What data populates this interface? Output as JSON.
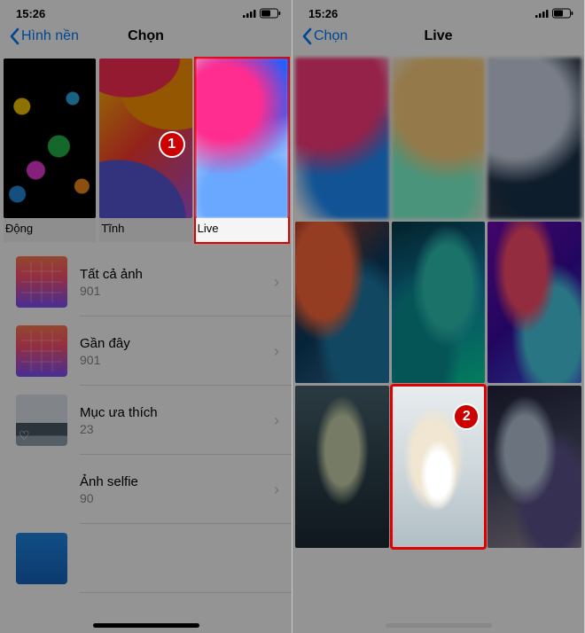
{
  "left": {
    "status": {
      "time": "15:26"
    },
    "nav": {
      "back": "Hình nền",
      "title": "Chọn"
    },
    "badge": "1",
    "categories": [
      {
        "label": "Động"
      },
      {
        "label": "Tĩnh"
      },
      {
        "label": "Live"
      }
    ],
    "albums": [
      {
        "title": "Tất cả ảnh",
        "count": "901"
      },
      {
        "title": "Gần đây",
        "count": "901"
      },
      {
        "title": "Mục ưa thích",
        "count": "23"
      },
      {
        "title": "Ảnh selfie",
        "count": "90"
      }
    ]
  },
  "right": {
    "status": {
      "time": "15:26"
    },
    "nav": {
      "back": "Chọn",
      "title": "Live"
    },
    "badge": "2"
  }
}
